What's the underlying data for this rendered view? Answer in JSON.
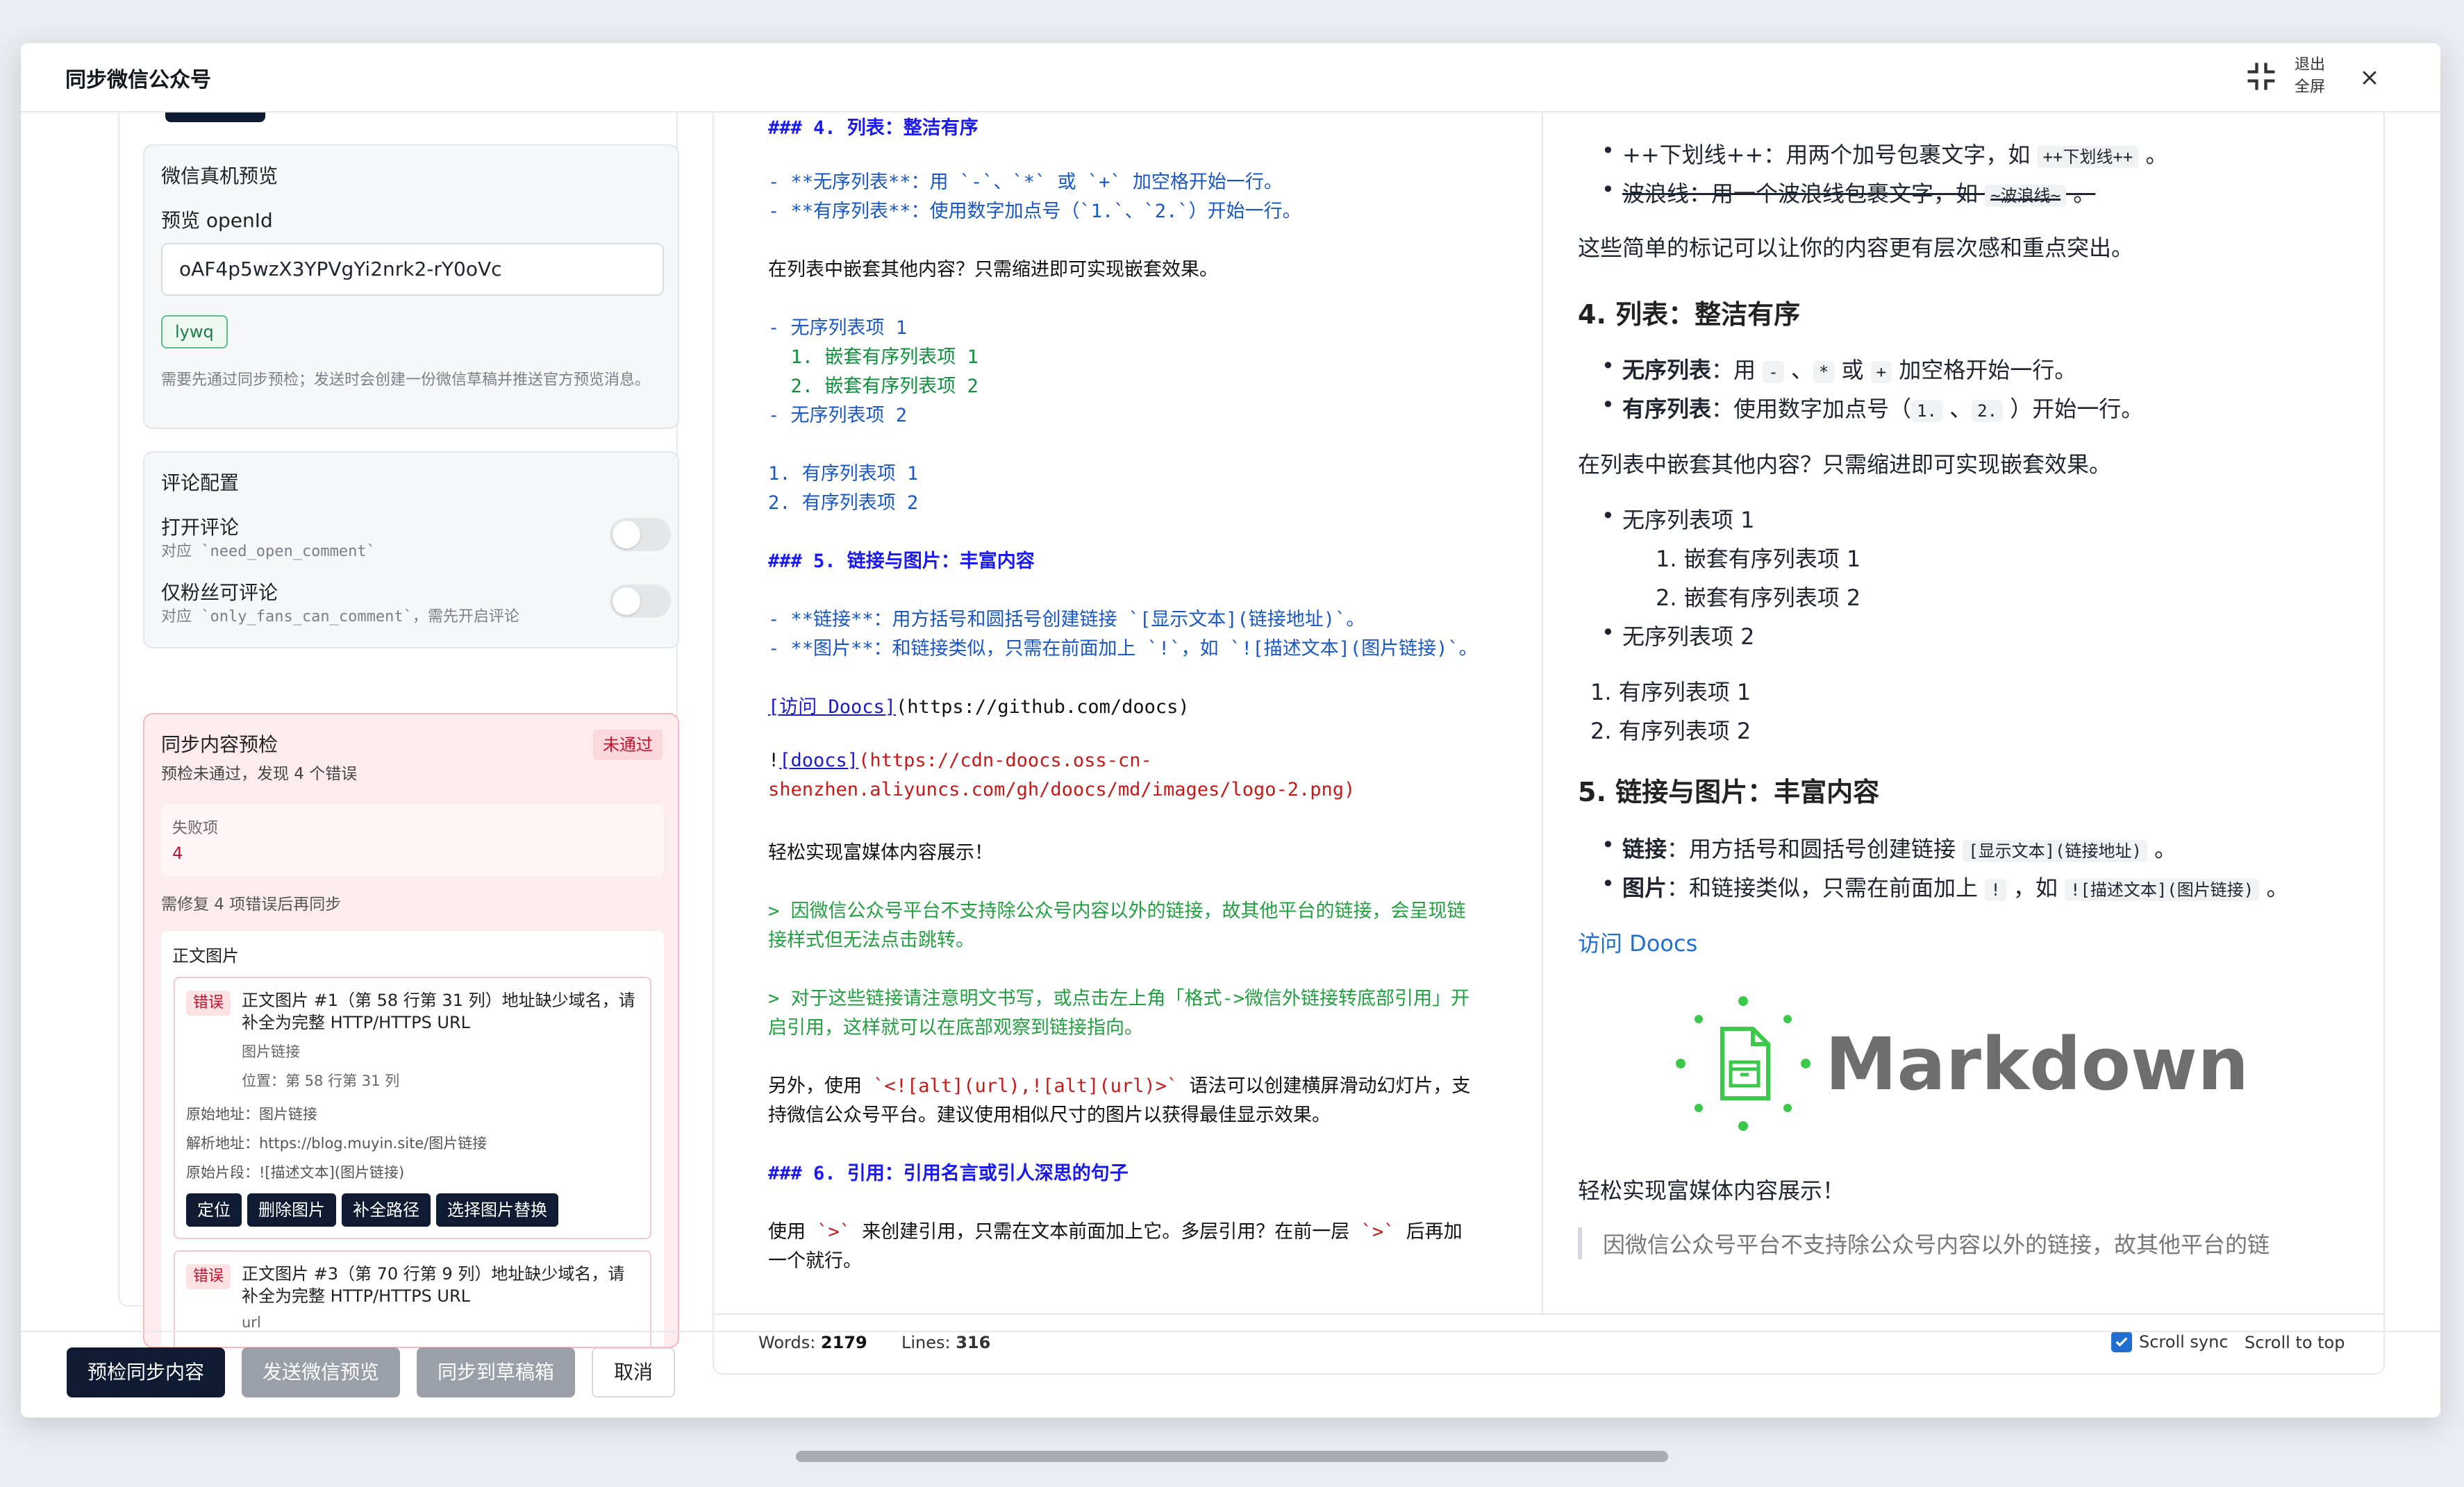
{
  "dialog": {
    "title": "同步微信公众号",
    "exit_fullscreen_label": "退出全屏"
  },
  "left": {
    "preview_card": {
      "title": "微信真机预览",
      "openid_label": "预览 openId",
      "openid_value": "oAF4p5wzX3YPVgYi2nrk2-rY0oVc",
      "tag": "lywq",
      "hint": "需要先通过同步预检；发送时会创建一份微信草稿并推送官方预览消息。"
    },
    "comment_card": {
      "title": "评论配置",
      "open_label": "打开评论",
      "open_sub": "对应 `need_open_comment`",
      "fans_label": "仅粉丝可评论",
      "fans_sub": "对应 `only_fans_can_comment`，需先开启评论"
    },
    "check_card": {
      "title": "同步内容预检",
      "status": "未通过",
      "summary": "预检未通过，发现 4 个错误",
      "fail_label": "失败项",
      "fail_count": "4",
      "notice": "需修复 4 项错误后再同步",
      "group_title": "正文图片",
      "errors": [
        {
          "badge": "错误",
          "title": "正文图片 #1（第 58 行第 31 列）地址缺少域名，请补全为完整 HTTP/HTTPS URL",
          "meta1": "图片链接",
          "meta2": "位置：第 58 行第 31 列",
          "orig": "原始地址：图片链接",
          "resolved": "解析地址：https://blog.muyin.site/图片链接",
          "snippet": "原始片段：![描述文本](图片链接)"
        },
        {
          "badge": "错误",
          "title": "正文图片 #3（第 70 行第 9 列）地址缺少域名，请补全为完整 HTTP/HTTPS URL",
          "meta1": "url"
        }
      ],
      "actions": {
        "locate": "定位",
        "delete": "删除图片",
        "fix_path": "补全路径",
        "replace": "选择图片替换"
      }
    }
  },
  "code": {
    "l1": "### 4. 列表：整洁有序",
    "l2": "- **无序列表**：用 `-`、`*` 或 `+` 加空格开始一行。",
    "l3": "- **有序列表**：使用数字加点号（`1.`、`2.`）开始一行。",
    "l4": "在列表中嵌套其他内容？只需缩进即可实现嵌套效果。",
    "l5": "- 无序列表项 1",
    "l6": "  1. 嵌套有序列表项 1",
    "l7": "  2. 嵌套有序列表项 2",
    "l8": "- 无序列表项 2",
    "l9": "1. 有序列表项 1",
    "l10": "2. 有序列表项 2",
    "l11": "### 5. 链接与图片：丰富内容",
    "l12": "- **链接**：用方括号和圆括号创建链接 `[显示文本](链接地址)`。",
    "l13": "- **图片**：和链接类似，只需在前面加上 `!`，如 `![描述文本](图片链接)`。",
    "l14a": "[访问 Doocs]",
    "l14b": "(https://github.com/doocs)",
    "l15a": "!",
    "l15b": "[doocs]",
    "l15c": "(https://cdn-doocs.oss-cn-",
    "l16": "shenzhen.aliyuncs.com/gh/doocs/md/images/logo-2.png)",
    "l17": "轻松实现富媒体内容展示！",
    "l18": "> 因微信公众号平台不支持除公众号内容以外的链接，故其他平台的链接，会呈现链",
    "l19": "接样式但无法点击跳转。",
    "l20": "> 对于这些链接请注意明文书写，或点击左上角「格式->微信外链接转底部引用」开",
    "l21": "启引用，这样就可以在底部观察到链接指向。",
    "l22a": "另外，使用 ",
    "l22b": "`<![alt](url),![alt](url)>`",
    "l22c": " 语法可以创建横屏滑动幻灯片，支",
    "l23": "持微信公众号平台。建议使用相似尺寸的图片以获得最佳显示效果。",
    "l24": "### 6. 引用：引用名言或引人深思的句子",
    "l25a": "使用 ",
    "l25b": "`>`",
    "l25c": " 来创建引用，只需在文本前面加上它。多层引用？在前一层 ",
    "l25d": "`>`",
    "l25e": " 后再加",
    "l26": "一个就行。"
  },
  "preview": {
    "b1a": "++下划线++：用两个加号包裹文字，如 ",
    "b1code": "++下划线++",
    "b1end": " 。",
    "b2a": "波浪线：用一个波浪线包裹文字，如 ",
    "b2code": "~波浪线~",
    "b2end": " 。",
    "p1": "这些简单的标记可以让你的内容更有层次感和重点突出。",
    "h4": "4. 列表：整洁有序",
    "ul1_bold": "无序列表",
    "ul1_text": "：用 ",
    "ul1_c1": "-",
    "ul1_sep1": " 、",
    "ul1_c2": "*",
    "ul1_or": " 或 ",
    "ul1_c3": "+",
    "ul1_end": " 加空格开始一行。",
    "ul2_bold": "有序列表",
    "ul2_text": "：使用数字加点号（",
    "ul2_c1": "1.",
    "ul2_sep": " 、",
    "ul2_c2": "2.",
    "ul2_end": " ）开始一行。",
    "p2": "在列表中嵌套其他内容？只需缩进即可实现嵌套效果。",
    "n1": "无序列表项 1",
    "n2": "1. 嵌套有序列表项 1",
    "n3": "2. 嵌套有序列表项 2",
    "n4": "无序列表项 2",
    "o1": "1. 有序列表项 1",
    "o2": "2. 有序列表项 2",
    "h5": "5. 链接与图片：丰富内容",
    "lk_bold": "链接",
    "lk_text": "：用方括号和圆括号创建链接 ",
    "lk_code": "[显示文本](链接地址)",
    "lk_end": " 。",
    "im_bold": "图片",
    "im_text": "：和链接类似，只需在前面加上 ",
    "im_c1": "!",
    "im_mid": " ，如 ",
    "im_c2": "![描述文本](图片链接)",
    "im_end": " 。",
    "visit": "访问 Doocs",
    "logo_text": "Markdown",
    "p3": "轻松实现富媒体内容展示！",
    "quote": "因微信公众号平台不支持除公众号内容以外的链接，故其他平台的链"
  },
  "status": {
    "words_label": "Words: ",
    "words": "2179",
    "lines_label": "Lines: ",
    "lines": "316",
    "scroll_sync": "Scroll sync",
    "scroll_top": "Scroll to top"
  },
  "footer": {
    "precheck": "预检同步内容",
    "send_preview": "发送微信预览",
    "sync_draft": "同步到草稿箱",
    "cancel": "取消"
  }
}
